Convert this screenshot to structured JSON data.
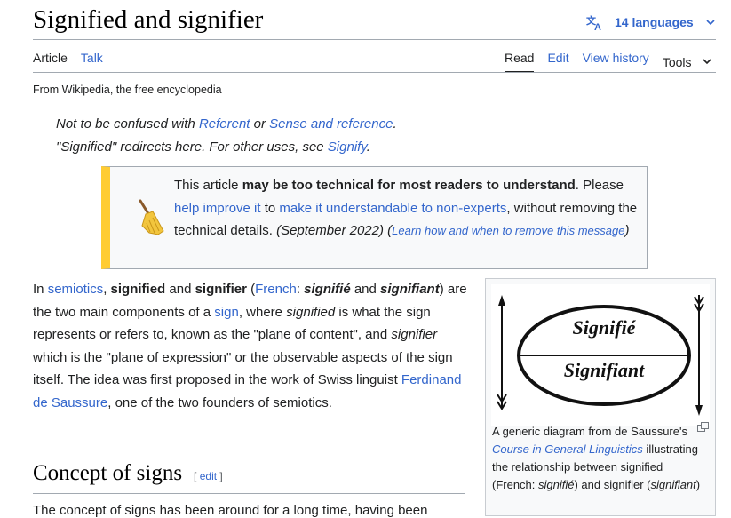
{
  "page": {
    "title": "Signified and signifier",
    "languages_label": "14 languages"
  },
  "tabs": {
    "article": "Article",
    "talk": "Talk",
    "read": "Read",
    "edit": "Edit",
    "view_history": "View history",
    "tools": "Tools"
  },
  "tagline": "From Wikipedia, the free encyclopedia",
  "hatnotes": {
    "line1": {
      "prefix": "Not to be confused with ",
      "link1": "Referent",
      "mid": " or ",
      "link2": "Sense and reference",
      "suffix": "."
    },
    "line2": {
      "prefix": "\"Signified\" redirects here. For other uses, see ",
      "link": "Signify",
      "suffix": "."
    }
  },
  "ambox": {
    "t1": "This article ",
    "bold": "may be too technical for most readers to understand",
    "t2": ". Please ",
    "link1": "help improve it",
    "t3": " to ",
    "link2": "make it understandable to non-experts",
    "t4": ", without removing the technical details. ",
    "date": "(September 2022)",
    "paren_open": " (",
    "small_link": "Learn how and when to remove this message",
    "paren_close": ")"
  },
  "intro": {
    "t1": "In ",
    "l_semiotics": "semiotics",
    "t2": ", ",
    "b_signified": "signified",
    "t3": " and ",
    "b_signifier": "signifier",
    "t4": " (",
    "l_french": "French",
    "t5": ": ",
    "bi_signifie": "signifié",
    "t6": " and ",
    "bi_signifiant": "signifiant",
    "t7": ") are the two main components of a ",
    "l_sign": "sign",
    "t8": ", where ",
    "i_signified": "signified",
    "t9": " is what the sign represents or refers to, known as the \"plane of content\", and ",
    "i_signifier": "signifier",
    "t10": " which is the \"plane of expression\" or the observable aspects of the sign itself. The idea was first proposed in the work of Swiss linguist ",
    "l_saussure": "Ferdinand de Saussure",
    "t11": ", one of the two founders of semiotics."
  },
  "section": {
    "heading": "Concept of signs",
    "edit_open": "[ ",
    "edit_label": "edit",
    "edit_close": " ]",
    "first_line": "The concept of signs has been around for a long time, having been"
  },
  "figure": {
    "signifie": "Signifié",
    "signifiant": "Signifiant",
    "caption": {
      "t1": "A generic diagram from de Saussure's ",
      "link": "Course in General Linguistics",
      "t2": " illustrating the relationship between signified (French: ",
      "i1": "signifié",
      "t3": ") and signifier (",
      "i2": "signifiant",
      "t4": ")"
    }
  },
  "colors": {
    "link": "#3366cc",
    "ambox_accent": "#ffcc33",
    "rule": "#a2a9b1"
  },
  "icons": [
    "translate-icon",
    "chevron-down-icon",
    "broom-icon",
    "enlarge-icon"
  ]
}
